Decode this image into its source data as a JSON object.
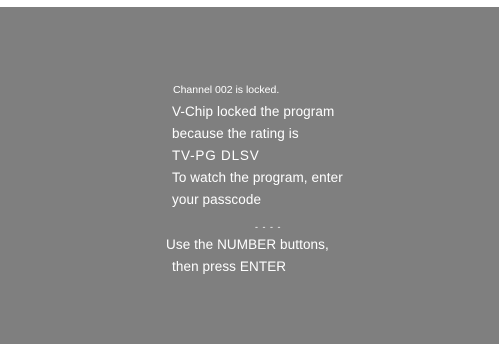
{
  "osd": {
    "locked_channel": "Channel 002 is locked.",
    "message_lines": [
      "V-Chip locked the program",
      "because the rating is",
      "TV-PG DLSV",
      "To watch the program, enter",
      "your passcode"
    ],
    "passcode_field": "- - - -",
    "instructions": [
      "Use the NUMBER buttons,",
      "then press ENTER"
    ]
  }
}
